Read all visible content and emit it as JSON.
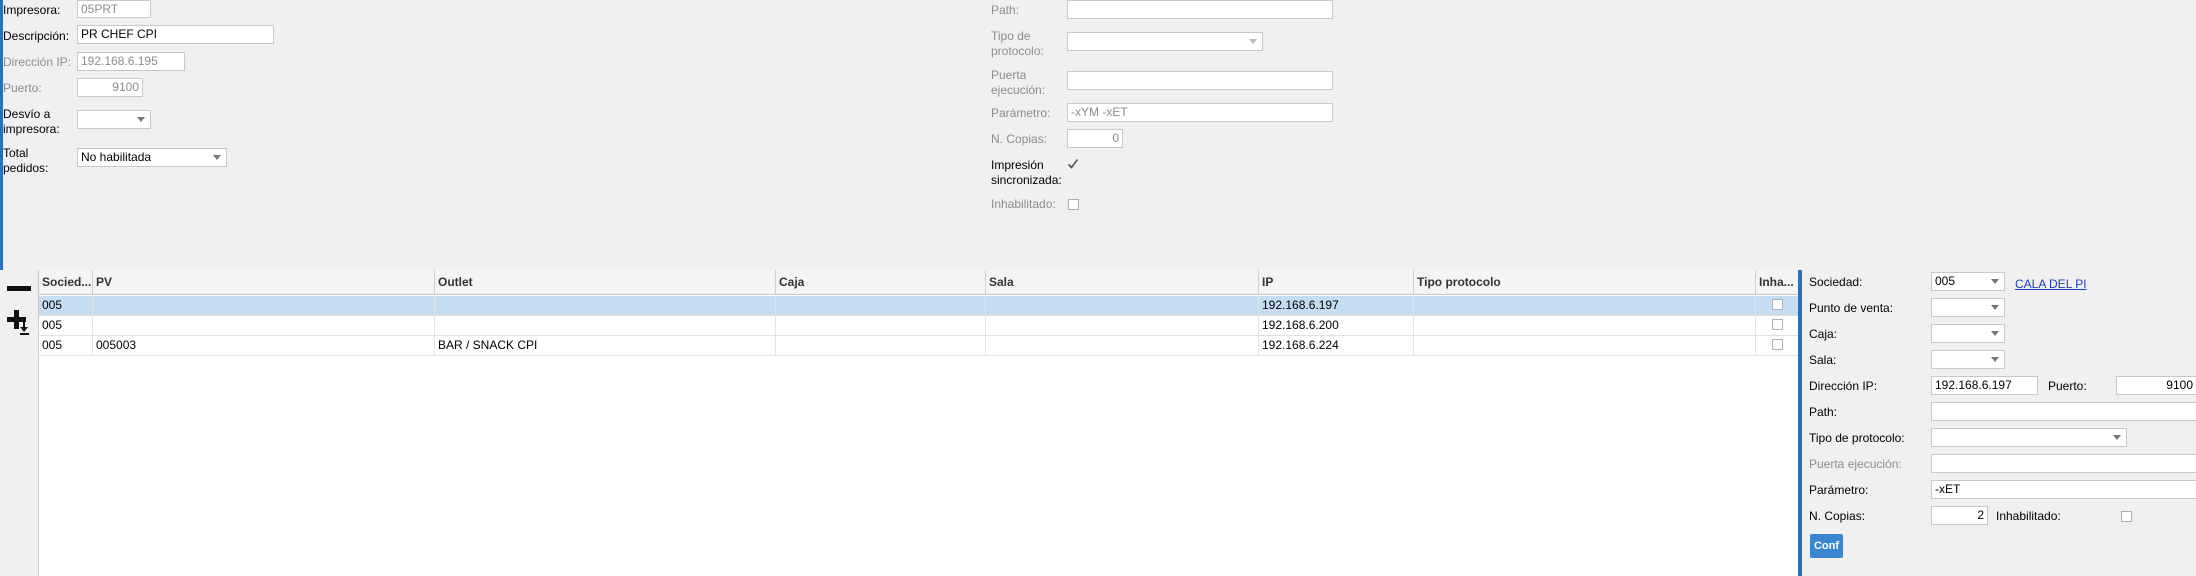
{
  "left_form": {
    "impresora_label": "Impresora:",
    "impresora_value": "05PRT",
    "descripcion_label": "Descripción:",
    "descripcion_value": "PR CHEF CPI",
    "direccion_ip_label": "Dirección IP:",
    "direccion_ip_value": "192.168.6.195",
    "puerto_label": "Puerto:",
    "puerto_value": "9100",
    "desvio_label_1": "Desvío a",
    "desvio_label_2": "impresora:",
    "desvio_value": "",
    "total_label_1": "Total",
    "total_label_2": "pedidos:",
    "total_value": "No habilitada"
  },
  "mid_form": {
    "path_label": "Path:",
    "path_value": "",
    "tipo_protocolo_label_1": "Tipo de",
    "tipo_protocolo_label_2": "protocolo:",
    "tipo_protocolo_value": "",
    "puerta_label_1": "Puerta",
    "puerta_label_2": "ejecución:",
    "puerta_value": "",
    "parametro_label": "Parámetro:",
    "parametro_value": "-xYM -xET",
    "copias_label": "N. Copias:",
    "copias_value": "0",
    "impresion_label_1": "Impresión",
    "impresion_label_2": "sincronizada:",
    "impresion_checked": true,
    "inhabilitado_label": "Inhabilitado:",
    "inhabilitado_checked": false
  },
  "toolbar": {
    "remove_icon": "minus-icon",
    "add_icon": "plus-download-icon"
  },
  "grid": {
    "columns": [
      "Socied...",
      "PV",
      "Outlet",
      "Caja",
      "Sala",
      "IP",
      "Tipo protocolo",
      "Inha..."
    ],
    "rows": [
      {
        "sociedad": "005",
        "pv": "",
        "outlet": "",
        "caja": "",
        "sala": "",
        "ip": "192.168.6.197",
        "tipo": "",
        "inhabilitado": false,
        "selected": true
      },
      {
        "sociedad": "005",
        "pv": "",
        "outlet": "",
        "caja": "",
        "sala": "",
        "ip": "192.168.6.200",
        "tipo": "",
        "inhabilitado": false,
        "selected": false
      },
      {
        "sociedad": "005",
        "pv": "005003",
        "outlet": "BAR / SNACK CPI",
        "caja": "",
        "sala": "",
        "ip": "192.168.6.224",
        "tipo": "",
        "inhabilitado": false,
        "selected": false
      }
    ]
  },
  "detail": {
    "sociedad_label": "Sociedad:",
    "sociedad_value": "005",
    "sociedad_link": "CALA DEL PI",
    "punto_venta_label": "Punto de venta:",
    "punto_venta_value": "",
    "caja_label": "Caja:",
    "caja_value": "",
    "sala_label": "Sala:",
    "sala_value": "",
    "direccion_ip_label": "Dirección IP:",
    "direccion_ip_value": "192.168.6.197",
    "puerto_label": "Puerto:",
    "puerto_value": "9100",
    "path_label": "Path:",
    "path_value": "",
    "tipo_protocolo_label": "Tipo de protocolo:",
    "tipo_protocolo_value": "",
    "puerta_label": "Puerta ejecución:",
    "puerta_value": "",
    "parametro_label": "Parámetro:",
    "parametro_value": "-xET",
    "copias_label": "N. Copias:",
    "copias_value": "2",
    "inhabilitado_label": "Inhabilitado:",
    "inhabilitado_checked": false,
    "confirm_label": "Conf"
  },
  "colors": {
    "accent": "#2a6fc0",
    "selected_row": "#c5dcf3",
    "button": "#3a87cf",
    "link": "#1a3fbf"
  }
}
